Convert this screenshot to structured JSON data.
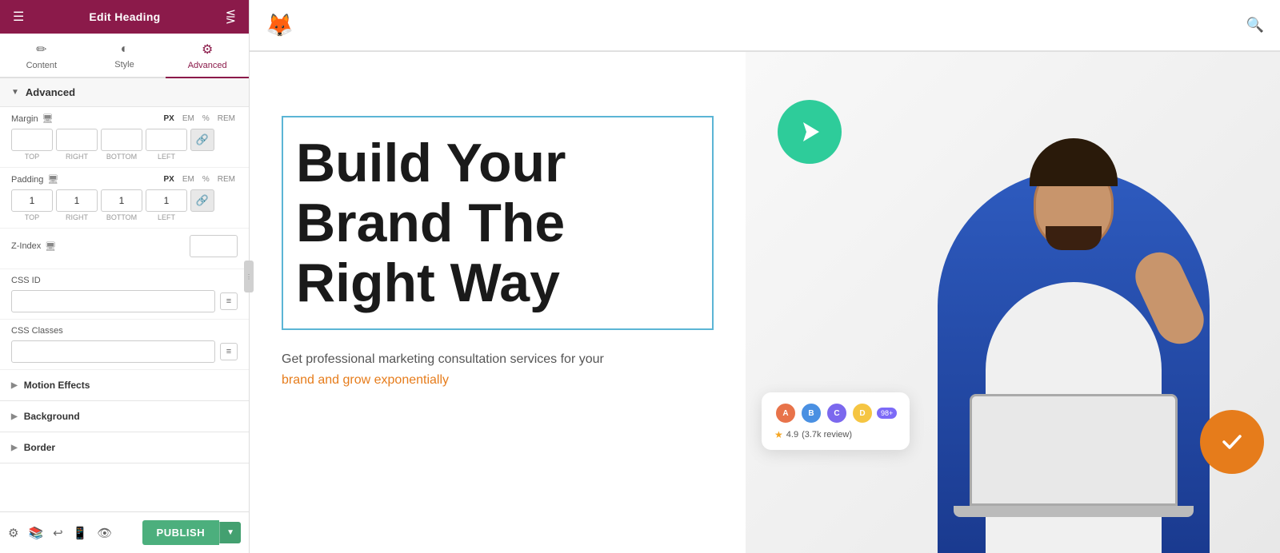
{
  "panel": {
    "header": {
      "title": "Edit Heading"
    },
    "tabs": [
      {
        "id": "content",
        "label": "Content",
        "icon": "✏️"
      },
      {
        "id": "style",
        "label": "Style",
        "icon": "🎨"
      },
      {
        "id": "advanced",
        "label": "Advanced",
        "icon": "⚙️"
      }
    ],
    "advanced_section": {
      "label": "Advanced",
      "margin": {
        "label": "Margin",
        "units": [
          "PX",
          "EM",
          "%",
          "REM"
        ],
        "active_unit": "PX",
        "top": "",
        "right": "",
        "bottom": "",
        "left": ""
      },
      "padding": {
        "label": "Padding",
        "units": [
          "PX",
          "EM",
          "%",
          "REM"
        ],
        "active_unit": "PX",
        "top": "1",
        "right": "1",
        "bottom": "1",
        "left": "1"
      },
      "z_index": {
        "label": "Z-Index",
        "value": ""
      },
      "css_id": {
        "label": "CSS ID",
        "value": ""
      },
      "css_classes": {
        "label": "CSS Classes",
        "value": ""
      }
    },
    "motion_effects": {
      "label": "Motion Effects"
    },
    "background": {
      "label": "Background"
    },
    "border": {
      "label": "Border"
    },
    "bottom_bar": {
      "icons": [
        "⚙️",
        "📚",
        "↩️",
        "📱",
        "👁️"
      ],
      "publish_label": "PUBLISH"
    }
  },
  "top_nav": {
    "logo_emoji": "🦊",
    "search_label": "Search"
  },
  "hero": {
    "heading": "Build Your Brand The Right Way",
    "subtext_line1": "Get professional marketing consultation services for your",
    "subtext_line2": "brand and grow exponentially",
    "rating": {
      "score": "4.9",
      "review_count": "(3.7k review)",
      "avatar_count": "98+"
    }
  }
}
